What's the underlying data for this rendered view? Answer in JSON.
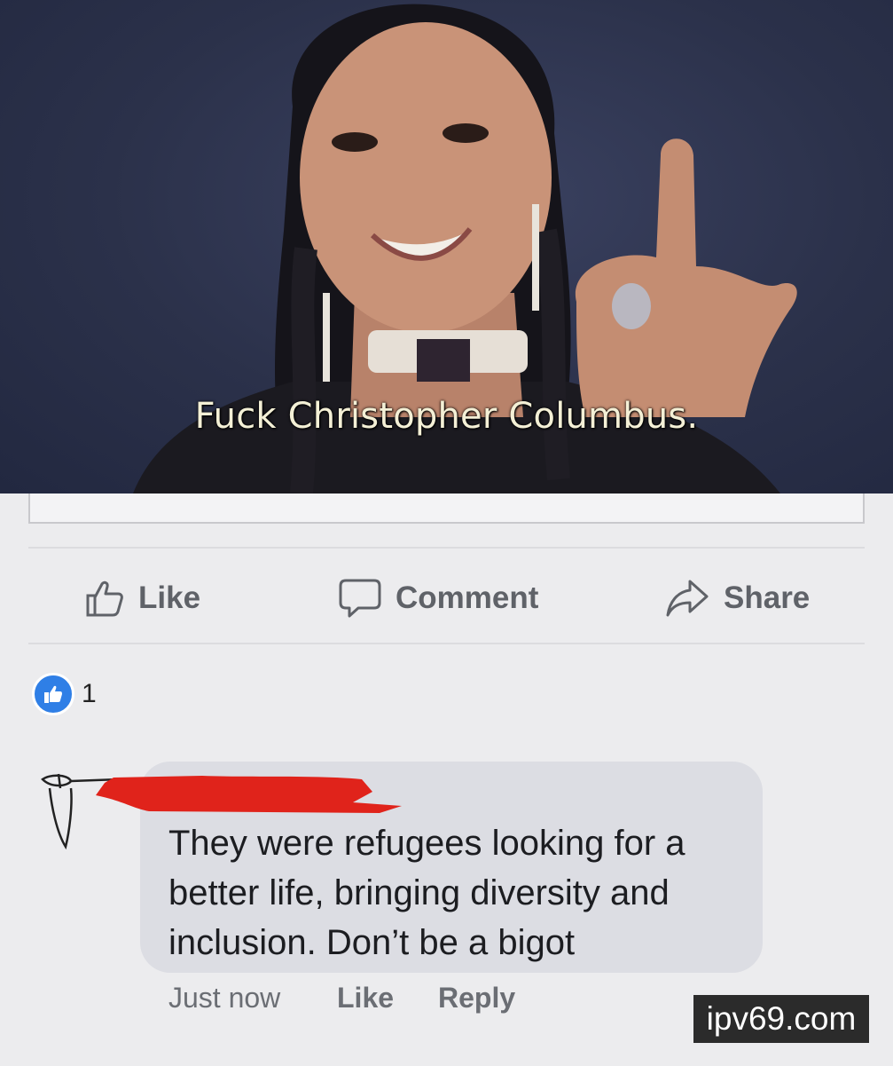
{
  "post": {
    "caption": "Fuck Christopher Columbus."
  },
  "actions": {
    "like_label": "Like",
    "comment_label": "Comment",
    "share_label": "Share"
  },
  "reactions": {
    "count": "1"
  },
  "comment": {
    "text": "They were refugees looking for a better life, bringing diversity and inclusion. Don’t be a bigot",
    "timestamp": "Just now",
    "like_label": "Like",
    "reply_label": "Reply"
  },
  "watermark": "ipv69.com",
  "colors": {
    "background": "#ececee",
    "comment_bubble": "#dcdde3",
    "like_badge": "#2f7fe6",
    "redaction": "#e0231b",
    "action_text": "#5f6268"
  },
  "icons": {
    "like": "thumbs-up-icon",
    "comment": "speech-bubble-icon",
    "share": "share-arrow-icon",
    "reaction": "like-reaction-icon"
  }
}
